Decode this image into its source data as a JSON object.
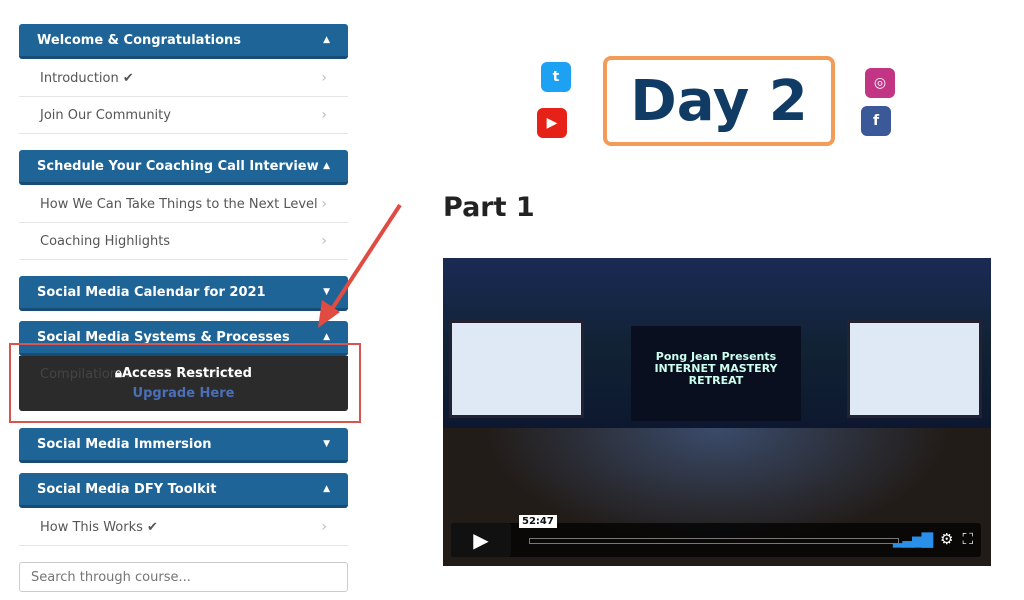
{
  "sidebar": {
    "sections": [
      {
        "title": "Welcome & Congratulations",
        "expanded": true,
        "items": [
          {
            "label": "Introduction ✔"
          },
          {
            "label": "Join Our Community"
          }
        ]
      },
      {
        "title": "Schedule Your Coaching Call Interview",
        "expanded": true,
        "items": [
          {
            "label": "How We Can Take Things to the Next Level"
          },
          {
            "label": "Coaching Highlights"
          }
        ]
      },
      {
        "title": "Social Media Calendar for 2021",
        "expanded": false
      },
      {
        "title": "Social Media Systems & Processes",
        "expanded": true,
        "items": [
          {
            "label": "Compilation ... ms & Processes",
            "locked": true
          }
        ]
      },
      {
        "title": "Social Media Immersion",
        "expanded": false
      },
      {
        "title": "Social Media DFY Toolkit",
        "expanded": true,
        "items": [
          {
            "label": "How This Works ✔"
          }
        ]
      }
    ],
    "locked": {
      "message": "Access Restricted",
      "link": "Upgrade Here"
    },
    "search_placeholder": "Search through course..."
  },
  "main": {
    "banner": "Day 2",
    "heading": "Part 1",
    "video": {
      "stage_text": "Pong Jean Presents INTERNET MASTERY RETREAT",
      "timestamp": "52:47",
      "progress": 0
    }
  },
  "colors": {
    "header": "#1f6497",
    "annotation": "#d9534f"
  }
}
